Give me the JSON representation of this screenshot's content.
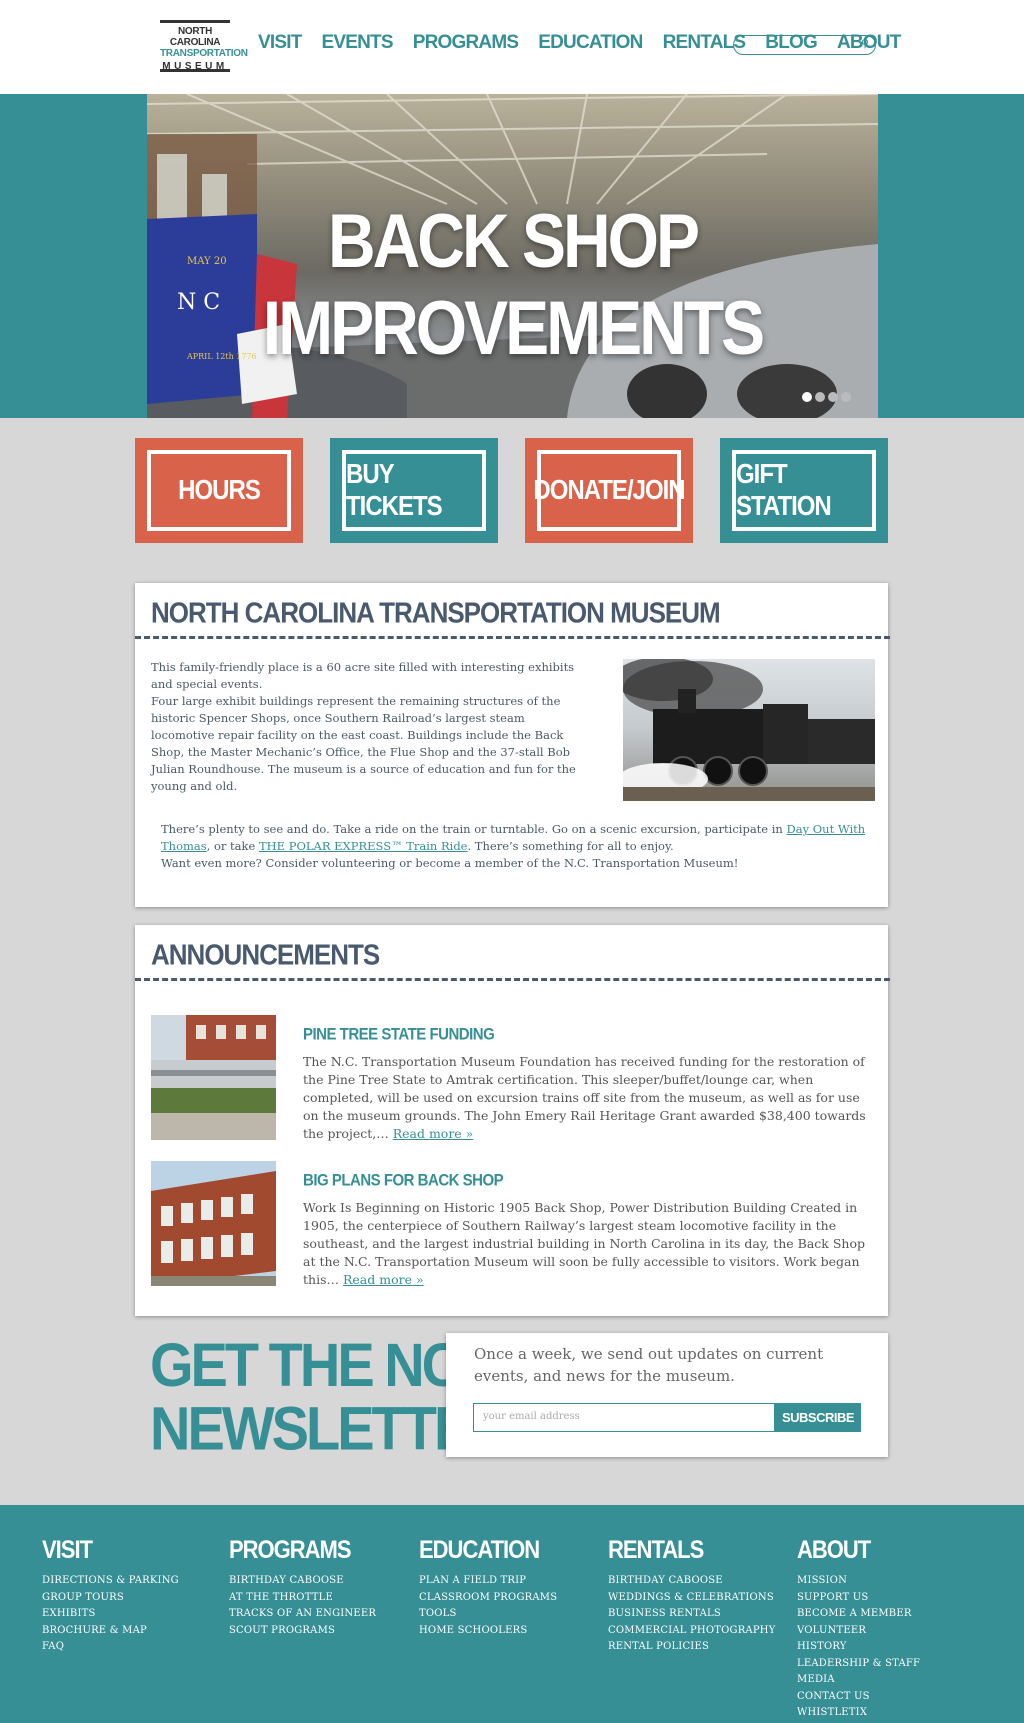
{
  "header": {
    "logo": {
      "line1": "NORTH CAROLINA",
      "line2": "TRANSPORTATION",
      "line3": "MUSEUM"
    },
    "nav": [
      "VISIT",
      "EVENTS",
      "PROGRAMS",
      "EDUCATION",
      "RENTALS",
      "BLOG",
      "ABOUT"
    ],
    "search": {
      "placeholder": "",
      "icon": "search-icon"
    }
  },
  "hero": {
    "title": "BACK SHOP IMPROVEMENTS",
    "slides": 4,
    "active_slide": 1,
    "flag_text_top": "MAY 20",
    "flag_text_bottom": "APRIL 12th 1776",
    "flag_letters": "N C"
  },
  "cta": {
    "hours": "HOURS",
    "tickets": "BUY TICKETS",
    "donate": "DONATE/JOIN",
    "gift": "GIFT STATION"
  },
  "about": {
    "title": "NORTH CAROLINA TRANSPORTATION MUSEUM",
    "intro1": "This family-friendly place is a 60 acre site filled with interesting exhibits and special events.",
    "intro2": "Four large exhibit buildings represent the remaining structures of the historic Spencer Shops, once Southern Railroad’s largest steam locomotive repair facility on the east coast. Buildings include the Back Shop, the Master Mechanic’s Office, the Flue Shop and the 37-stall Bob Julian Roundhouse. The museum is a source of education and fun for the young and old.",
    "more_a": "There’s plenty to see and do. Take a ride on the train or turntable. Go on a scenic excursion, participate in ",
    "link_thomas": "Day Out With Thomas",
    "more_b": ", or take ",
    "link_polar": "THE POLAR EXPRESS™ Train Ride",
    "more_c": ". There’s something for all to enjoy.",
    "more_d": "Want even more? Consider volunteering or become a member of the N.C. Transportation Museum!"
  },
  "announcements": {
    "title": "ANNOUNCEMENTS",
    "items": [
      {
        "title": "PINE TREE STATE FUNDING",
        "body": "The N.C. Transportation Museum Foundation has received funding for the restoration of the Pine Tree State to Amtrak certification.  This sleeper/buffet/lounge car, when completed, will be used on excursion trains off site from the museum, as well as for use on the museum grounds.  The John Emery Rail Heritage Grant awarded $38,400 towards the project,…",
        "read_more": "Read more »"
      },
      {
        "title": "BIG PLANS FOR BACK SHOP",
        "body": "Work Is Beginning on Historic 1905 Back Shop, Power Distribution Building Created in 1905, the centerpiece of Southern Railway’s largest steam locomotive facility in the southeast, and the largest industrial building in North Carolina in its day, the Back Shop at the N.C. Transportation Museum will soon be fully accessible to visitors. Work began this…",
        "read_more": "Read more »"
      }
    ]
  },
  "newsletter": {
    "title_line1": "GET THE NCRM",
    "title_line2": "NEWSLETTER",
    "text": "Once a week, we send out updates on current events, and news for the museum.",
    "placeholder": "your email address",
    "button": "SUBSCRIBE"
  },
  "footer": {
    "visit": {
      "title": "VISIT",
      "items": [
        "DIRECTIONS & PARKING",
        "GROUP TOURS",
        "EXHIBITS",
        "BROCHURE & MAP",
        "FAQ"
      ]
    },
    "programs": {
      "title": "PROGRAMS",
      "items": [
        "BIRTHDAY CABOOSE",
        "AT THE THROTTLE",
        "TRACKS OF AN ENGINEER",
        "SCOUT PROGRAMS"
      ]
    },
    "education": {
      "title": "EDUCATION",
      "items": [
        "PLAN A FIELD TRIP",
        "CLASSROOM PROGRAMS",
        "TOOLS",
        "HOME SCHOOLERS"
      ]
    },
    "rentals": {
      "title": "RENTALS",
      "items": [
        "BIRTHDAY CABOOSE",
        "WEDDINGS & CELEBRATIONS",
        "BUSINESS RENTALS",
        "COMMERCIAL PHOTOGRAPHY",
        "RENTAL POLICIES"
      ]
    },
    "about": {
      "title": "ABOUT",
      "items": [
        "MISSION",
        "SUPPORT US",
        "BECOME A MEMBER",
        "VOLUNTEER",
        "HISTORY",
        "LEADERSHIP & STAFF",
        "MEDIA",
        "CONTACT US",
        "WHISTLETIX"
      ]
    }
  },
  "colors": {
    "teal": "#368f95",
    "orange": "#d9634a",
    "slate": "#4a5a6e",
    "page_bg": "#d7d7d7"
  }
}
